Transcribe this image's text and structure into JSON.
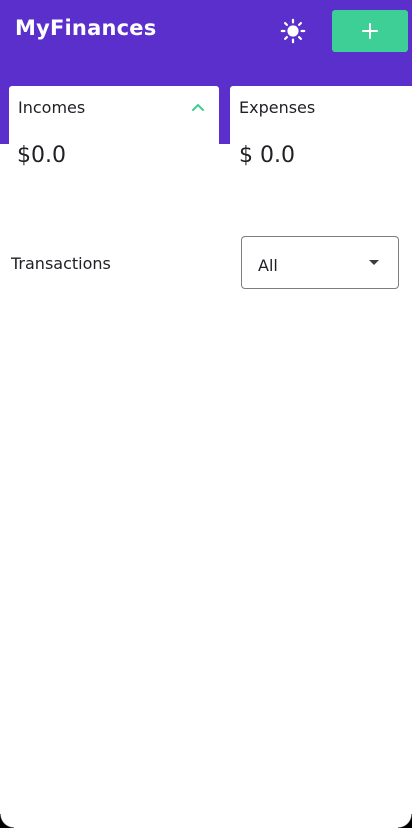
{
  "app": {
    "title": "MyFinances"
  },
  "header": {
    "theme_toggle_icon": "sun-icon",
    "add_button_icon": "plus-icon"
  },
  "summary": {
    "incomes": {
      "label": "Incomes",
      "value": "$0.0",
      "icon": "chevron-up-icon"
    },
    "expenses": {
      "label": "Expenses",
      "value": "$ 0.0"
    }
  },
  "transactions": {
    "label": "Transactions",
    "filter": {
      "selected": "All"
    },
    "items": []
  },
  "colors": {
    "header_bg": "#5b2fcb",
    "accent": "#3ecf96",
    "text": "#1f1f24"
  }
}
